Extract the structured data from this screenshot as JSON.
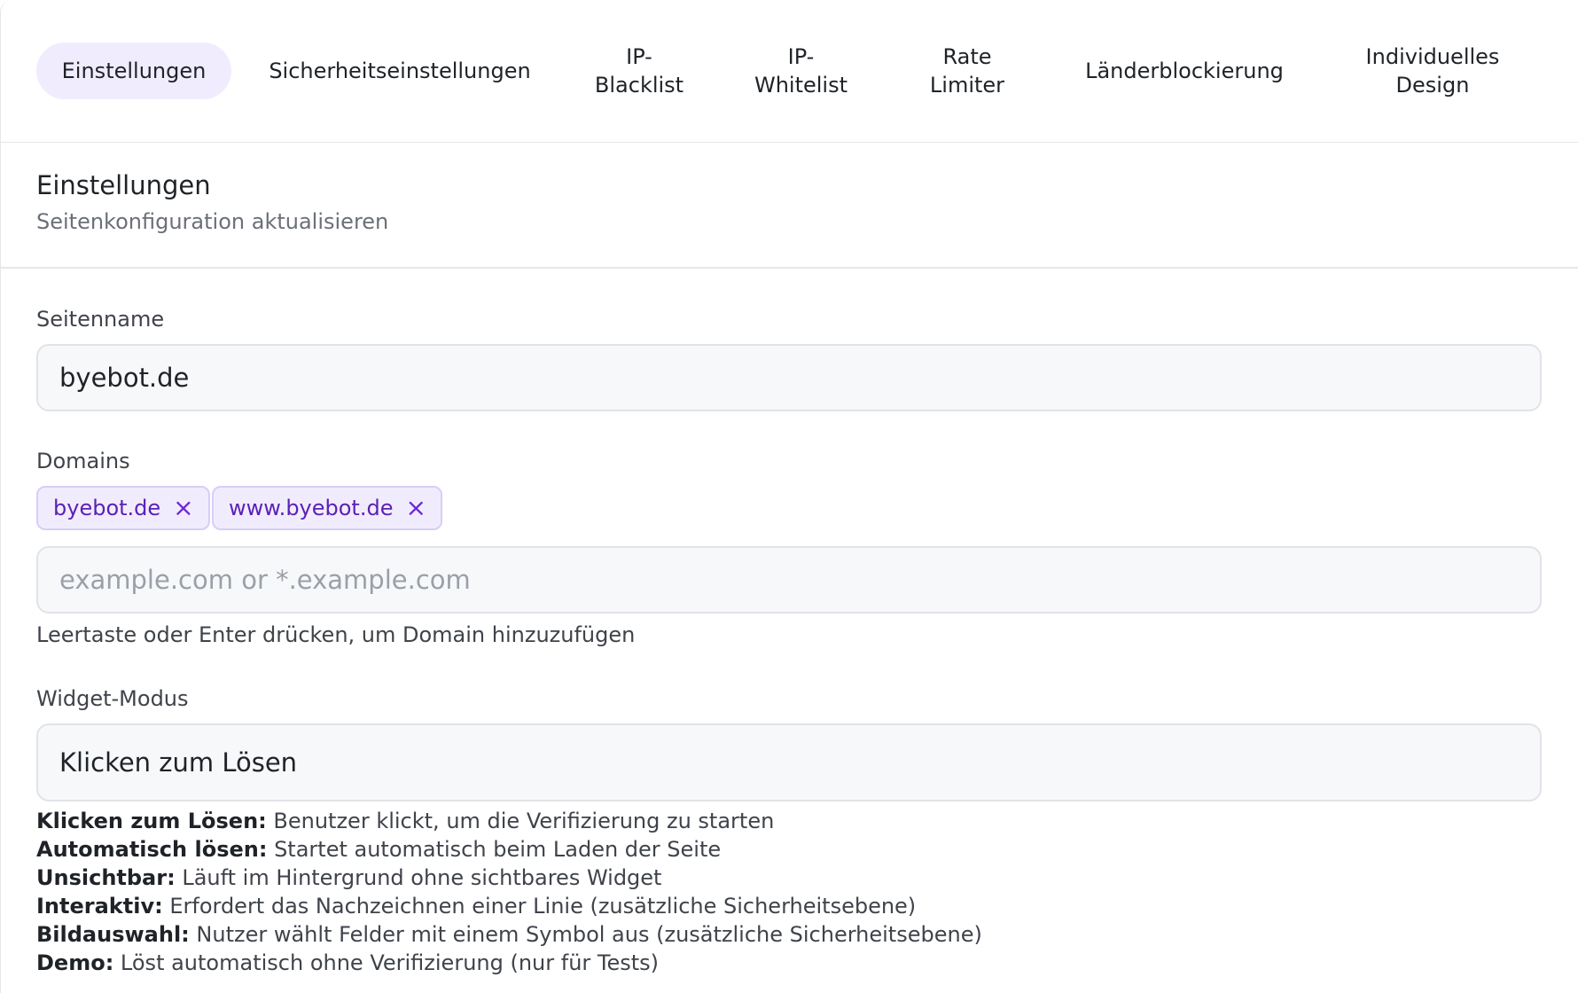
{
  "tabs": [
    {
      "label": "Einstellungen",
      "active": true
    },
    {
      "label": "Sicherheitseinstellungen"
    },
    {
      "label": "IP-\nBlacklist"
    },
    {
      "label": "IP-\nWhitelist"
    },
    {
      "label": "Rate\nLimiter"
    },
    {
      "label": "Länderblockierung"
    },
    {
      "label": "Individuelles\nDesign"
    }
  ],
  "section": {
    "title": "Einstellungen",
    "subtitle": "Seitenkonfiguration aktualisieren"
  },
  "form": {
    "site_name_label": "Seitenname",
    "site_name_value": "byebot.de",
    "domains_label": "Domains",
    "domains": [
      "byebot.de",
      "www.byebot.de"
    ],
    "domain_placeholder": "example.com or *.example.com",
    "domain_help": "Leertaste oder Enter drücken, um Domain hinzuzufügen",
    "widget_label": "Widget-Modus",
    "widget_value": "Klicken zum Lösen",
    "widget_modes": [
      {
        "name": "Klicken zum Lösen:",
        "desc": " Benutzer klickt, um die Verifizierung zu starten"
      },
      {
        "name": "Automatisch lösen:",
        "desc": " Startet automatisch beim Laden der Seite"
      },
      {
        "name": "Unsichtbar:",
        "desc": " Läuft im Hintergrund ohne sichtbares Widget"
      },
      {
        "name": "Interaktiv:",
        "desc": " Erfordert das Nachzeichnen einer Linie (zusätzliche Sicherheitsebene)"
      },
      {
        "name": "Bildauswahl:",
        "desc": " Nutzer wählt Felder mit einem Symbol aus (zusätzliche Sicherheitsebene)"
      },
      {
        "name": "Demo:",
        "desc": " Löst automatisch ohne Verifizierung (nur für Tests)"
      }
    ]
  },
  "colors": {
    "accent": "#6d28d9",
    "accent_bg": "#f1ecfd",
    "chip_border": "#d9cdf7"
  },
  "icons": {
    "chip_remove": "close-icon"
  }
}
